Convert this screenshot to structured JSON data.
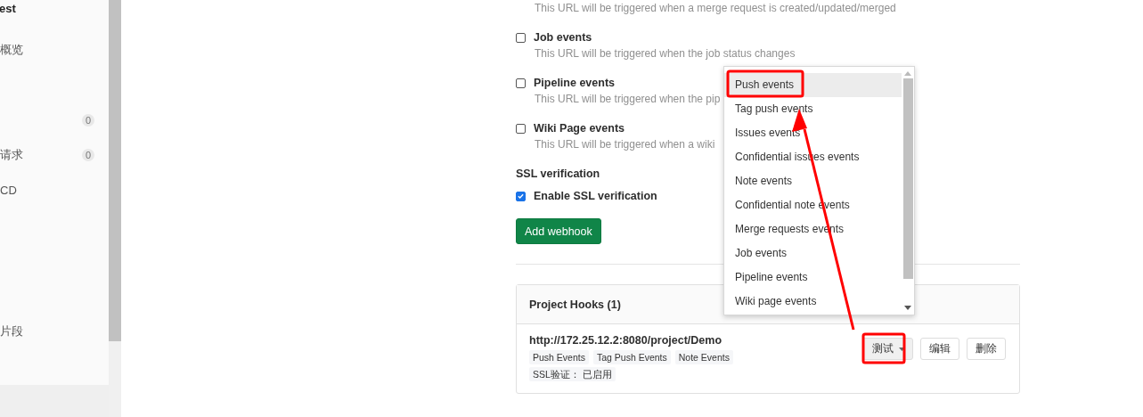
{
  "sidebar": {
    "items": [
      {
        "label": "est",
        "kind": "header"
      },
      {
        "label": "概览",
        "kind": "link"
      },
      {
        "badge": "0",
        "kind": "link"
      },
      {
        "label": "请求",
        "badge": "0",
        "kind": "link"
      },
      {
        "label": "CD",
        "kind": "link"
      },
      {
        "label": "片段",
        "kind": "link"
      }
    ]
  },
  "events": [
    {
      "description": "This URL will be triggered when a merge request is created/updated/merged"
    },
    {
      "label": "Job events",
      "checked": false,
      "description": "This URL will be triggered when the job status changes"
    },
    {
      "label": "Pipeline events",
      "checked": false,
      "description": "This URL will be triggered when the pip"
    },
    {
      "label": "Wiki Page events",
      "checked": false,
      "description": "This URL will be triggered when a wiki"
    }
  ],
  "ssl": {
    "heading": "SSL verification",
    "label": "Enable SSL verification",
    "checked": true
  },
  "add_button": "Add webhook",
  "hooks": {
    "title": "Project Hooks (1)",
    "items": [
      {
        "url": "http://172.25.12.2:8080/project/Demo",
        "tags": [
          "Push Events",
          "Tag Push Events",
          "Note Events"
        ],
        "ssl_tag": "SSL验证： 已启用",
        "buttons": [
          {
            "label": "测试",
            "kind": "dropdown"
          },
          {
            "label": "编辑",
            "kind": "plain"
          },
          {
            "label": "删除",
            "kind": "plain"
          }
        ]
      }
    ]
  },
  "test_menu": {
    "items": [
      {
        "label": "Push events",
        "selected": true
      },
      {
        "label": "Tag push events",
        "selected": false
      },
      {
        "label": "Issues events",
        "selected": false
      },
      {
        "label": "Confidential issues events",
        "selected": false
      },
      {
        "label": "Note events",
        "selected": false
      },
      {
        "label": "Confidential note events",
        "selected": false
      },
      {
        "label": "Merge requests events",
        "selected": false
      },
      {
        "label": "Job events",
        "selected": false
      },
      {
        "label": "Pipeline events",
        "selected": false
      },
      {
        "label": "Wiki page events",
        "selected": false
      }
    ]
  }
}
